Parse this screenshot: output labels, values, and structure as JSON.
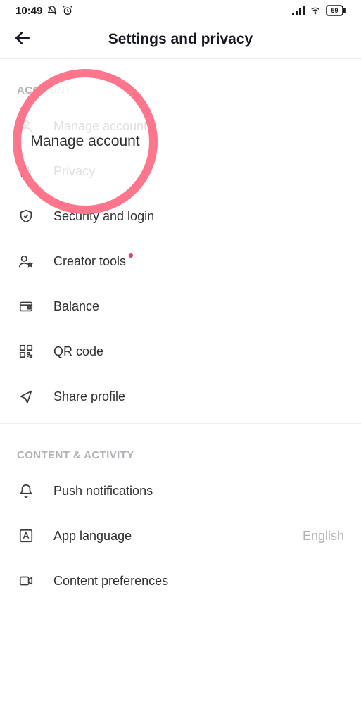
{
  "status": {
    "time": "10:49",
    "battery": "59"
  },
  "header": {
    "title": "Settings and privacy"
  },
  "sections": {
    "account": {
      "label": "ACCOUNT",
      "items": {
        "manage": "Manage account",
        "privacy": "Privacy",
        "security": "Security and login",
        "creator": "Creator tools",
        "balance": "Balance",
        "qr": "QR code",
        "share": "Share profile"
      }
    },
    "content": {
      "label": "CONTENT & ACTIVITY",
      "items": {
        "push": "Push notifications",
        "lang": "App language",
        "lang_value": "English",
        "pref": "Content preferences"
      }
    }
  },
  "highlight": {
    "label": "Manage account"
  }
}
